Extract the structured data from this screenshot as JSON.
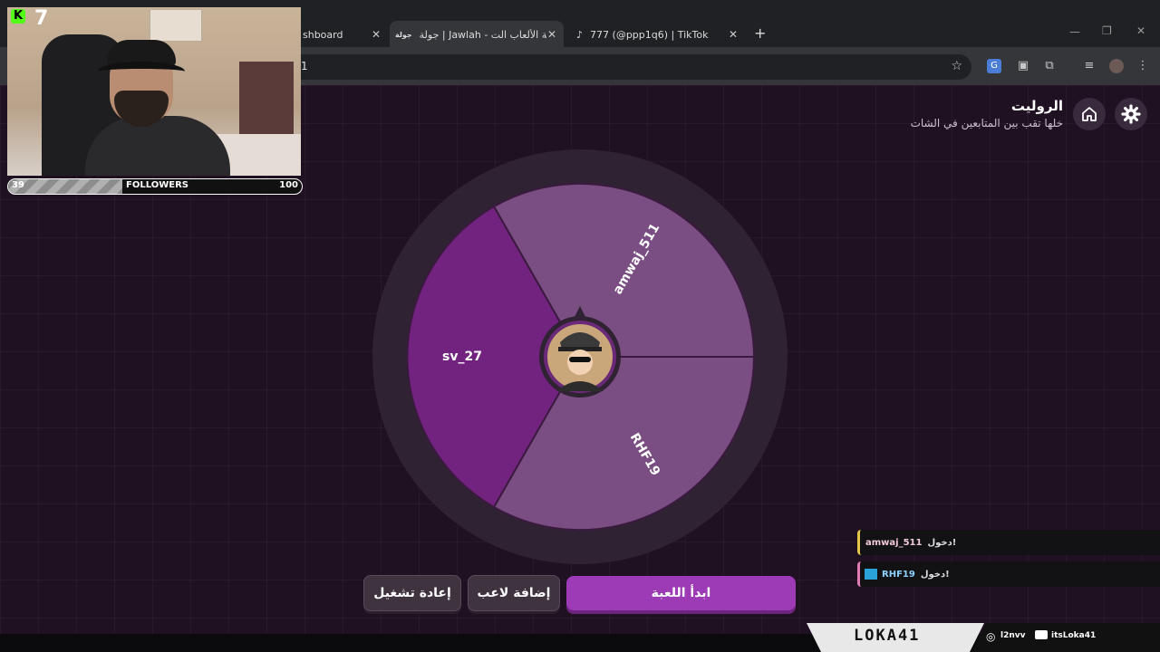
{
  "stream_overlay": {
    "viewer_count": "7",
    "kick_logo": "K",
    "followers_label": "FOLLOWERS",
    "followers_current": "39",
    "followers_goal": "100",
    "followers_progress": 0.39,
    "brand_name": "LOKA41",
    "instagram_handle": "l2nvv",
    "youtube_handle": "itsLoka41"
  },
  "browser": {
    "tabs": [
      {
        "label": "shboard",
        "active": false
      },
      {
        "label": "جولة | Jawlah - منصة الألعاب الت",
        "favicon": "جولة",
        "active": true
      },
      {
        "label": "777 (@ppp1q6) | TikTok",
        "active": false
      }
    ],
    "new_tab": "+",
    "omnibox_text": "1"
  },
  "page": {
    "title": "الروليت",
    "subtitle": "خلها تقب بين المتابعين في الشات",
    "wheel": {
      "segments": [
        {
          "label": "amwaj_511",
          "color": "#7a4e82"
        },
        {
          "label": "RHF19",
          "color": "#7a4e82"
        },
        {
          "label": "sv_27",
          "color": "#72237f"
        }
      ]
    },
    "buttons": {
      "start": "ابدأ اللعبة",
      "add_player": "إضافة لاعب",
      "restart": "إعادة تشغيل"
    }
  },
  "chat": [
    {
      "user": "amwaj_511",
      "message": "دخول!"
    },
    {
      "user": "RHF19",
      "message": "دخول!"
    }
  ],
  "colors": {
    "accent": "#9c3bb5",
    "page_bg": "#1f1121",
    "kick_green": "#53fc18"
  }
}
